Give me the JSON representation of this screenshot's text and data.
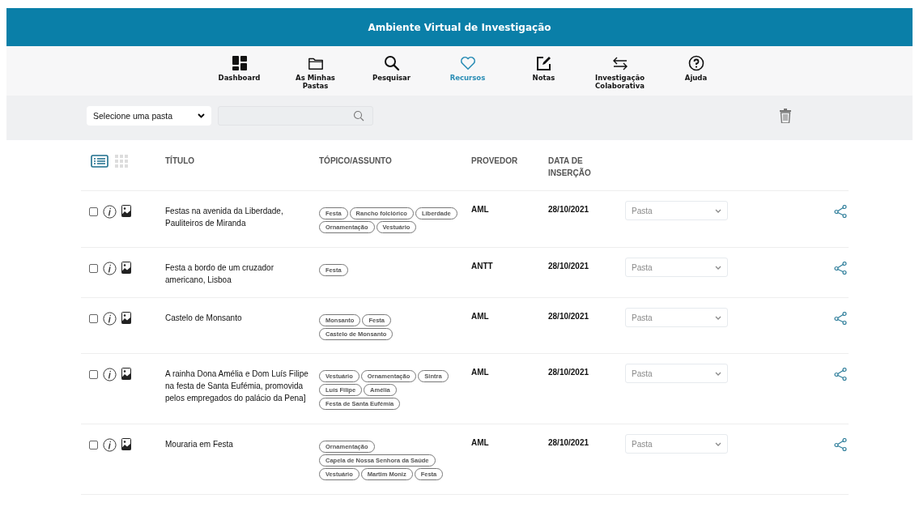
{
  "header": {
    "title": "Ambiente Virtual de Investigação"
  },
  "nav": [
    {
      "label": "Dashboard",
      "selected": false
    },
    {
      "label": "As Minhas Pastas",
      "selected": false
    },
    {
      "label": "Pesquisar",
      "selected": false
    },
    {
      "label": "Recursos",
      "selected": true
    },
    {
      "label": "Notas",
      "selected": false
    },
    {
      "label": "Investigação Colaborativa",
      "selected": false
    },
    {
      "label": "Ajuda",
      "selected": false
    }
  ],
  "toolbar": {
    "folder_select": "Selecione uma pasta"
  },
  "view_modes": [
    {
      "kind": "list",
      "selected": true
    },
    {
      "kind": "grid",
      "selected": false
    }
  ],
  "table": {
    "columns": [
      "TÍTULO",
      "TÓPICO/ASSUNTO",
      "PROVEDOR",
      "DATA DE INSERÇÃO"
    ],
    "rows": [
      {
        "checked": false,
        "title": "Festas na avenida da Liberdade, Pauliteiros de Miranda",
        "topics": [
          "Festa",
          "Rancho folclórico",
          "Liberdade",
          "Ornamentação",
          "Vestuário"
        ],
        "provider": "AML",
        "date": "28/10/2021",
        "folder": "Pasta"
      },
      {
        "checked": false,
        "title": "Festa a bordo de um cruzador americano, Lisboa",
        "topics": [
          "Festa"
        ],
        "provider": "ANTT",
        "date": "28/10/2021",
        "folder": "Pasta"
      },
      {
        "checked": false,
        "title": "Castelo de Monsanto",
        "topics": [
          "Monsanto",
          "Festa",
          "Castelo de Monsanto"
        ],
        "provider": "AML",
        "date": "28/10/2021",
        "folder": "Pasta"
      },
      {
        "checked": false,
        "title": "A rainha Dona Amélia e Dom Luís Filipe na festa de Santa Eufémia, promovida pelos empregados do palácio da Pena]",
        "topics": [
          "Vestuário",
          "Ornamentação",
          "Sintra",
          "Luís Filipe",
          "Amélia",
          "Festa de Santa Eufémia"
        ],
        "provider": "AML",
        "date": "28/10/2021",
        "folder": "Pasta"
      },
      {
        "checked": false,
        "title": "Mouraria em Festa",
        "topics": [
          "Ornamentação",
          "Capela de Nossa Senhora da Saúde",
          "Vestuário",
          "Martim Moniz",
          "Festa"
        ],
        "provider": "AML",
        "date": "28/10/2021",
        "folder": "Pasta"
      }
    ]
  }
}
